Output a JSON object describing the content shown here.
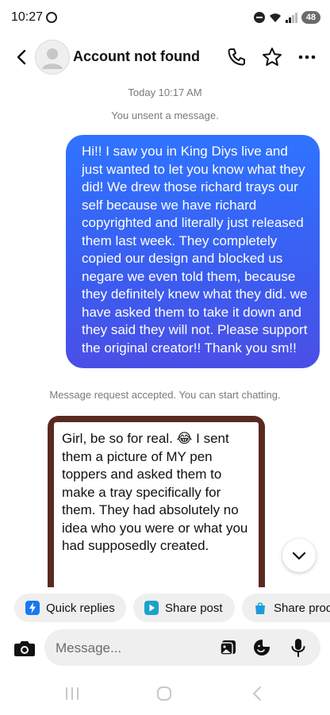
{
  "status_bar": {
    "time": "10:27",
    "battery": "48",
    "icons": [
      "whatsapp-icon",
      "do-not-disturb-icon",
      "wifi-icon",
      "signal-icon",
      "battery-icon"
    ]
  },
  "header": {
    "title": "Account not found"
  },
  "chat": {
    "timestamp": "Today 10:17 AM",
    "unsent_notice": "You unsent a message.",
    "outgoing_message": "Hi!! I saw you in King Diys live and just wanted to let you know what they did! We drew those richard trays our self because we have richard copyrighted and literally just released them last week. They completely copied our design and blocked us negare we even told them, because they definitely knew what they did. we have asked them to take it down  and they said they will not. Please support the original creator!! Thank you sm!!",
    "system_message": "Message request accepted. You can start chatting.",
    "image_message_text": "Girl, be so for real. 😂 I sent them a picture of MY pen toppers and asked them to make a tray specifically for them. They had absolutely no idea who you were or what you had supposedly created."
  },
  "quick_actions": {
    "quick_replies": "Quick replies",
    "share_post": "Share post",
    "share_product": "Share product"
  },
  "composer": {
    "placeholder": "Message..."
  },
  "colors": {
    "bubble_blue_top": "#2f73ff",
    "bubble_blue_bottom": "#4b4fe6",
    "quick_reply_icon": "#1877f2",
    "share_post_icon": "#1aa3c9",
    "share_product_icon": "#1c9cd8"
  }
}
